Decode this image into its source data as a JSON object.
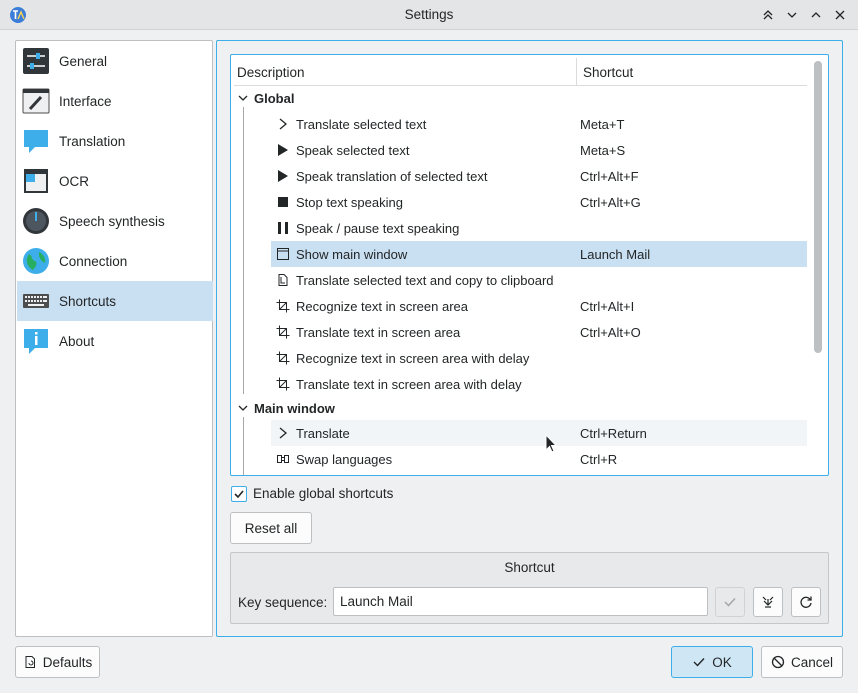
{
  "window": {
    "title": "Settings"
  },
  "sidebar": {
    "items": [
      {
        "label": "General",
        "icon": "sliders-icon"
      },
      {
        "label": "Interface",
        "icon": "paintbrush-icon"
      },
      {
        "label": "Translation",
        "icon": "chat-bubble-icon"
      },
      {
        "label": "OCR",
        "icon": "scan-window-icon"
      },
      {
        "label": "Speech synthesis",
        "icon": "speaker-knob-icon"
      },
      {
        "label": "Connection",
        "icon": "globe-icon"
      },
      {
        "label": "Shortcuts",
        "icon": "keyboard-icon",
        "selected": true
      },
      {
        "label": "About",
        "icon": "info-icon"
      }
    ]
  },
  "tree": {
    "header": {
      "description": "Description",
      "shortcut": "Shortcut"
    },
    "groups": [
      {
        "label": "Global",
        "items": [
          {
            "description": "Translate selected text",
            "shortcut": "Meta+T",
            "icon": "chevron-right-icon"
          },
          {
            "description": "Speak selected text",
            "shortcut": "Meta+S",
            "icon": "play-icon"
          },
          {
            "description": "Speak translation of selected text",
            "shortcut": "Ctrl+Alt+F",
            "icon": "play-icon"
          },
          {
            "description": "Stop text speaking",
            "shortcut": "Ctrl+Alt+G",
            "icon": "stop-icon"
          },
          {
            "description": "Speak / pause text speaking",
            "shortcut": "",
            "icon": "pause-icon"
          },
          {
            "description": "Show main window",
            "shortcut": "Launch Mail",
            "icon": "window-icon",
            "selected": true
          },
          {
            "description": "Translate selected text and copy to clipboard",
            "shortcut": "",
            "icon": "copy-icon"
          },
          {
            "description": "Recognize text in screen area",
            "shortcut": "Ctrl+Alt+I",
            "icon": "crop-icon"
          },
          {
            "description": "Translate text in screen area",
            "shortcut": "Ctrl+Alt+O",
            "icon": "crop-icon"
          },
          {
            "description": "Recognize text in screen area with delay",
            "shortcut": "",
            "icon": "crop-icon"
          },
          {
            "description": "Translate text in screen area with delay",
            "shortcut": "",
            "icon": "crop-icon"
          }
        ]
      },
      {
        "label": "Main window",
        "items": [
          {
            "description": "Translate",
            "shortcut": "Ctrl+Return",
            "icon": "chevron-right-icon"
          },
          {
            "description": "Swap languages",
            "shortcut": "Ctrl+R",
            "icon": "swap-icon"
          }
        ]
      }
    ]
  },
  "enable_global": {
    "label": "Enable global shortcuts",
    "checked": true
  },
  "reset_all": "Reset all",
  "shortcut_box": {
    "title": "Shortcut",
    "key_sequence_label": "Key sequence:",
    "key_sequence_value": "Launch Mail"
  },
  "footer": {
    "defaults": "Defaults",
    "ok": "OK",
    "cancel": "Cancel"
  },
  "colors": {
    "accent": "#3daee9",
    "selection": "#c9dff2",
    "background": "#eff0f1"
  }
}
